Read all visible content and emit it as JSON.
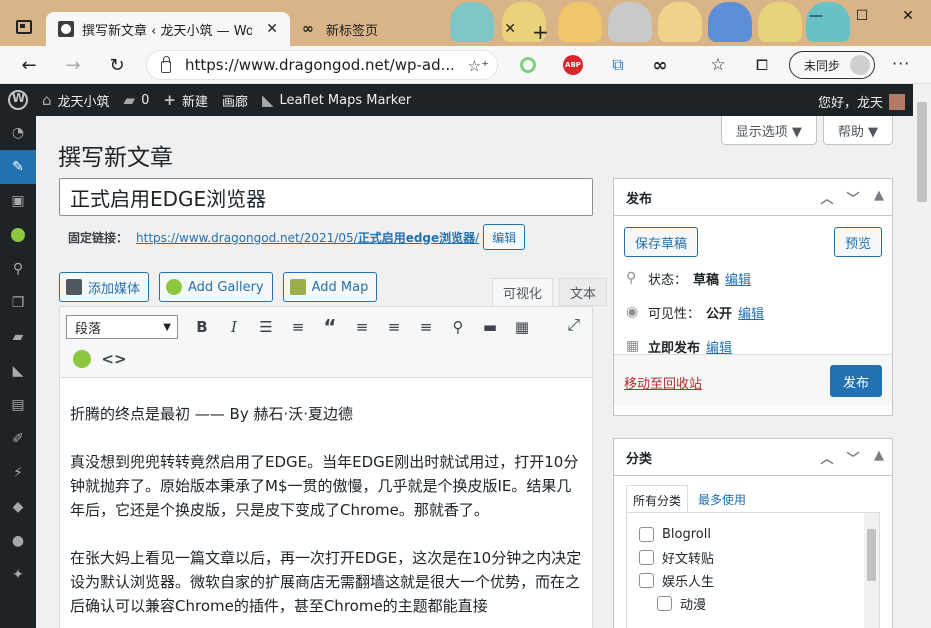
{
  "browser": {
    "tabs": [
      {
        "title": "撰写新文章 ‹ 龙天小筑 — WordPress",
        "active": true
      },
      {
        "title": "新标签页",
        "active": false
      }
    ],
    "url": "https://www.dragongod.net/wp-ad...",
    "profile_label": "未同步",
    "extensions": [
      "ring-extension-icon",
      "abp-icon",
      "sync-extension-icon",
      "infinity-icon"
    ],
    "abp_text": "ABP"
  },
  "adminbar": {
    "site_name": "龙天小筑",
    "comments_count": "0",
    "new_label": "新建",
    "gallery_label": "画廊",
    "plugin_label": "Leaflet Maps Marker",
    "greeting": "您好，龙天"
  },
  "screen_options": {
    "display": "显示选项 ▼",
    "help": "帮助 ▼"
  },
  "page": {
    "title": "撰写新文章",
    "post_title": "正式启用EDGE浏览器",
    "permalink_label": "固定链接：",
    "permalink_base": "https://www.dragongod.net/2021/05/",
    "permalink_slug": "正式启用edge浏览器",
    "permalink_tail": "/",
    "permalink_edit": "编辑"
  },
  "media_buttons": {
    "add_media": "添加媒体",
    "add_gallery": "Add Gallery",
    "add_map": "Add Map"
  },
  "editor": {
    "tab_visual": "可视化",
    "tab_text": "文本",
    "format_select": "段落",
    "paragraphs": [
      "折腾的终点是最初 —— By 赫石·沃·夏边德",
      "真没想到兜兜转转竟然启用了EDGE。当年EDGE刚出时就试用过，打开10分钟就抛弃了。原始版本秉承了M$一贯的傲慢，几乎就是个换皮版IE。结果几年后，它还是个换皮版，只是皮下变成了Chrome。那就香了。",
      "在张大妈上看见一篇文章以后，再一次打开EDGE，这次是在10分钟之内决定设为默认浏览器。微软自家的扩展商店无需翻墙这就是很大一个优势，而在之后确认可以兼容Chrome的插件，甚至Chrome的主题都能直接"
    ]
  },
  "publish_box": {
    "title": "发布",
    "save_draft": "保存草稿",
    "preview": "预览",
    "status_label": "状态：",
    "status_value": "草稿",
    "visibility_label": "可见性：",
    "visibility_value": "公开",
    "schedule_label": "立即发布",
    "edit": "编辑",
    "trash": "移动至回收站",
    "publish": "发布"
  },
  "category_box": {
    "title": "分类",
    "tab_all": "所有分类",
    "tab_popular": "最多使用",
    "items": [
      {
        "label": "Blogroll",
        "child": false
      },
      {
        "label": "好文转贴",
        "child": false
      },
      {
        "label": "娱乐人生",
        "child": false
      },
      {
        "label": "动漫",
        "child": true
      }
    ]
  },
  "colors": {
    "wp_blue": "#2271b1",
    "admin_bar": "#1d2327",
    "trash_red": "#b32d2e",
    "tabbar_bg": "#d9b486"
  }
}
